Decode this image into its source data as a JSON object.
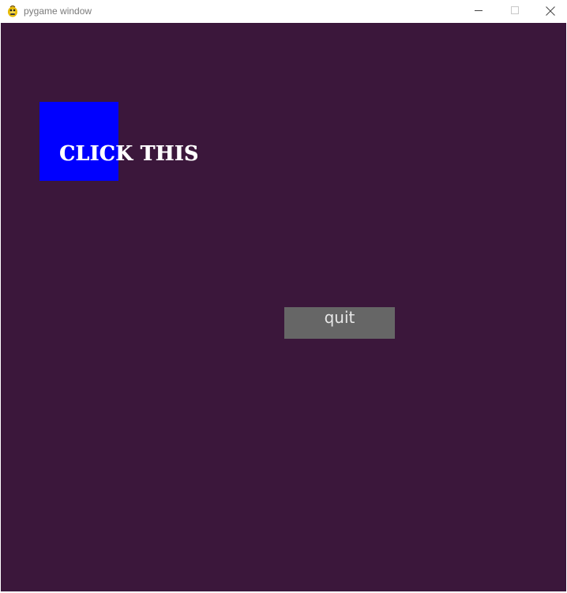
{
  "window": {
    "title": "pygame window",
    "icon": "pygame-snake-icon",
    "controls": {
      "minimize_icon": "minimize-icon",
      "maximize_icon": "maximize-icon",
      "close_icon": "close-icon"
    }
  },
  "game": {
    "background_color": "#3b173b",
    "click_target": {
      "label": "CLICK THIS",
      "box_color": "#0000ff",
      "text_color": "#ffffff"
    },
    "quit_button": {
      "label": "quit",
      "button_color": "#666666",
      "text_color": "#e8e8e8"
    }
  }
}
